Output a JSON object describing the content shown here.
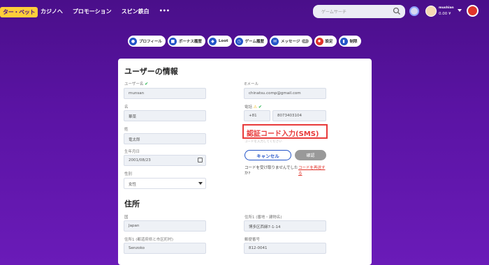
{
  "header": {
    "logo_text": "ター・ベット",
    "nav": [
      "カジノへ",
      "プロモーション",
      "スピン鉄白",
      "•••"
    ],
    "search_placeholder": "ゲームサーチ",
    "user_name": "mushian",
    "balance": "0.00 ¥"
  },
  "tabs": [
    {
      "label": "プロフィール",
      "icon": "user-icon"
    },
    {
      "label": "ボーナス履歴",
      "icon": "gift-icon"
    },
    {
      "label": "Loot",
      "icon": "loot-icon"
    },
    {
      "label": "ゲーム履歴",
      "icon": "clock-icon"
    },
    {
      "label": "メッセージ",
      "icon": "mail-icon",
      "count": "2"
    },
    {
      "label": "設定",
      "icon": "gear-icon"
    },
    {
      "label": "制限",
      "icon": "limit-icon"
    }
  ],
  "profile": {
    "title": "ユーザーの情報",
    "username_label": "ユーザー名",
    "username": "munsan",
    "first_name_label": "名",
    "first_name": "華菜",
    "last_name_label": "姓",
    "last_name": "竜太郎",
    "dob_label": "生年月日",
    "dob": "2001/08/23",
    "gender_label": "性別",
    "gender": "女性",
    "email_label": "Eメール",
    "email": "chinatsu.comp@gmail.com",
    "phone_label": "電話",
    "phone_code": "+81",
    "phone": "8073403104",
    "sms_overlay": "認証コード入力(SMS)",
    "sms_sub": "コードを入力してください",
    "cancel": "キャンセル",
    "confirm": "確認",
    "resend_question": "コードを受け取りませんでしたか?",
    "resend_link": "コードを再送する"
  },
  "address": {
    "title": "住所",
    "country_label": "国",
    "country": "Japan",
    "address1_label": "住所1 (番地・建物名)",
    "address1": "博多区西縁7-1-14",
    "pref_label": "住所1 (都道府県と市区町村)",
    "pref": "Senzoko",
    "postal_label": "郵便番号",
    "postal": "812-0041"
  }
}
